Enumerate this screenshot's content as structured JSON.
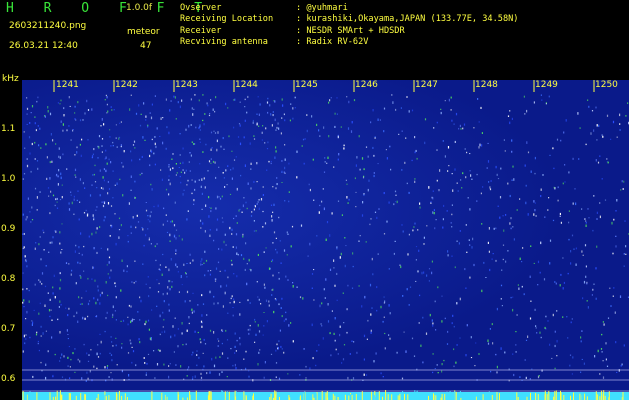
{
  "header": {
    "brand": "H R O F F T",
    "version": "1.0.0f",
    "filename": "2603211240.png",
    "datetime": "26.03.21 12:40",
    "detection_label": "meteor",
    "detection_count": "47"
  },
  "station": [
    {
      "label": "Ovserver",
      "value": ": @yuhmari"
    },
    {
      "label": "Receiving Location",
      "value": ": kurashiki,Okayama,JAPAN (133.77E, 34.58N)"
    },
    {
      "label": "Receiver",
      "value": ": NESDR SMArt + HDSDR"
    },
    {
      "label": "Recviving antenna",
      "value": ": Radix RV-62V"
    }
  ],
  "y_unit": "kHz",
  "y_ticks": [
    "1.1",
    "1.0",
    "0.9",
    "0.8",
    "0.7",
    "0.6"
  ],
  "x_ticks": [
    "1241",
    "1242",
    "1243",
    "1244",
    "1245",
    "1246",
    "1247",
    "1248",
    "1249",
    "1250"
  ],
  "colors": {
    "background": "#0a1a8a",
    "header_text": "#ffff40",
    "brand": "#39e639",
    "signal": "#40e0ff",
    "grid_line": "#d0d0ff"
  }
}
